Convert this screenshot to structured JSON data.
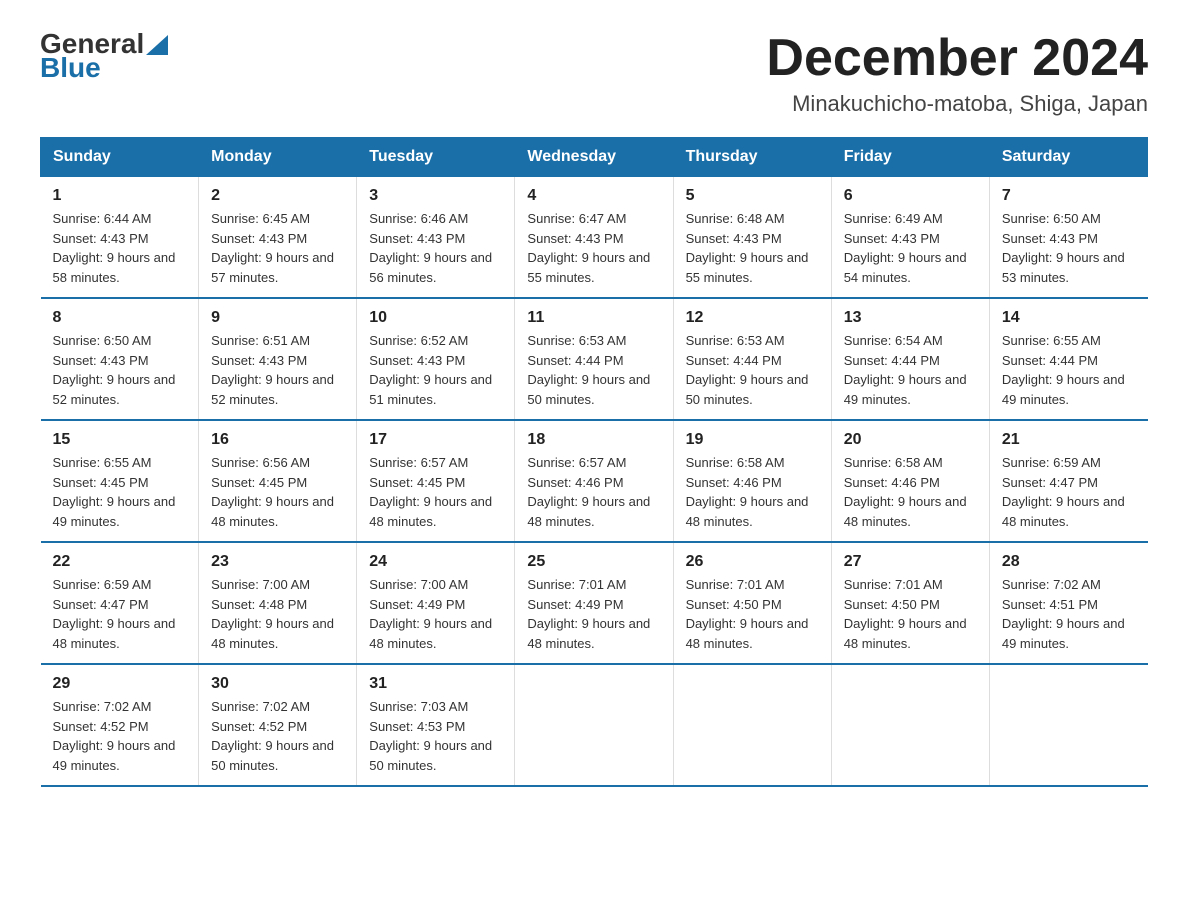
{
  "header": {
    "logo_general": "General",
    "logo_blue": "Blue",
    "month_title": "December 2024",
    "location": "Minakuchicho-matoba, Shiga, Japan"
  },
  "weekdays": [
    "Sunday",
    "Monday",
    "Tuesday",
    "Wednesday",
    "Thursday",
    "Friday",
    "Saturday"
  ],
  "weeks": [
    [
      {
        "day": "1",
        "sunrise": "6:44 AM",
        "sunset": "4:43 PM",
        "daylight": "9 hours and 58 minutes."
      },
      {
        "day": "2",
        "sunrise": "6:45 AM",
        "sunset": "4:43 PM",
        "daylight": "9 hours and 57 minutes."
      },
      {
        "day": "3",
        "sunrise": "6:46 AM",
        "sunset": "4:43 PM",
        "daylight": "9 hours and 56 minutes."
      },
      {
        "day": "4",
        "sunrise": "6:47 AM",
        "sunset": "4:43 PM",
        "daylight": "9 hours and 55 minutes."
      },
      {
        "day": "5",
        "sunrise": "6:48 AM",
        "sunset": "4:43 PM",
        "daylight": "9 hours and 55 minutes."
      },
      {
        "day": "6",
        "sunrise": "6:49 AM",
        "sunset": "4:43 PM",
        "daylight": "9 hours and 54 minutes."
      },
      {
        "day": "7",
        "sunrise": "6:50 AM",
        "sunset": "4:43 PM",
        "daylight": "9 hours and 53 minutes."
      }
    ],
    [
      {
        "day": "8",
        "sunrise": "6:50 AM",
        "sunset": "4:43 PM",
        "daylight": "9 hours and 52 minutes."
      },
      {
        "day": "9",
        "sunrise": "6:51 AM",
        "sunset": "4:43 PM",
        "daylight": "9 hours and 52 minutes."
      },
      {
        "day": "10",
        "sunrise": "6:52 AM",
        "sunset": "4:43 PM",
        "daylight": "9 hours and 51 minutes."
      },
      {
        "day": "11",
        "sunrise": "6:53 AM",
        "sunset": "4:44 PM",
        "daylight": "9 hours and 50 minutes."
      },
      {
        "day": "12",
        "sunrise": "6:53 AM",
        "sunset": "4:44 PM",
        "daylight": "9 hours and 50 minutes."
      },
      {
        "day": "13",
        "sunrise": "6:54 AM",
        "sunset": "4:44 PM",
        "daylight": "9 hours and 49 minutes."
      },
      {
        "day": "14",
        "sunrise": "6:55 AM",
        "sunset": "4:44 PM",
        "daylight": "9 hours and 49 minutes."
      }
    ],
    [
      {
        "day": "15",
        "sunrise": "6:55 AM",
        "sunset": "4:45 PM",
        "daylight": "9 hours and 49 minutes."
      },
      {
        "day": "16",
        "sunrise": "6:56 AM",
        "sunset": "4:45 PM",
        "daylight": "9 hours and 48 minutes."
      },
      {
        "day": "17",
        "sunrise": "6:57 AM",
        "sunset": "4:45 PM",
        "daylight": "9 hours and 48 minutes."
      },
      {
        "day": "18",
        "sunrise": "6:57 AM",
        "sunset": "4:46 PM",
        "daylight": "9 hours and 48 minutes."
      },
      {
        "day": "19",
        "sunrise": "6:58 AM",
        "sunset": "4:46 PM",
        "daylight": "9 hours and 48 minutes."
      },
      {
        "day": "20",
        "sunrise": "6:58 AM",
        "sunset": "4:46 PM",
        "daylight": "9 hours and 48 minutes."
      },
      {
        "day": "21",
        "sunrise": "6:59 AM",
        "sunset": "4:47 PM",
        "daylight": "9 hours and 48 minutes."
      }
    ],
    [
      {
        "day": "22",
        "sunrise": "6:59 AM",
        "sunset": "4:47 PM",
        "daylight": "9 hours and 48 minutes."
      },
      {
        "day": "23",
        "sunrise": "7:00 AM",
        "sunset": "4:48 PM",
        "daylight": "9 hours and 48 minutes."
      },
      {
        "day": "24",
        "sunrise": "7:00 AM",
        "sunset": "4:49 PM",
        "daylight": "9 hours and 48 minutes."
      },
      {
        "day": "25",
        "sunrise": "7:01 AM",
        "sunset": "4:49 PM",
        "daylight": "9 hours and 48 minutes."
      },
      {
        "day": "26",
        "sunrise": "7:01 AM",
        "sunset": "4:50 PM",
        "daylight": "9 hours and 48 minutes."
      },
      {
        "day": "27",
        "sunrise": "7:01 AM",
        "sunset": "4:50 PM",
        "daylight": "9 hours and 48 minutes."
      },
      {
        "day": "28",
        "sunrise": "7:02 AM",
        "sunset": "4:51 PM",
        "daylight": "9 hours and 49 minutes."
      }
    ],
    [
      {
        "day": "29",
        "sunrise": "7:02 AM",
        "sunset": "4:52 PM",
        "daylight": "9 hours and 49 minutes."
      },
      {
        "day": "30",
        "sunrise": "7:02 AM",
        "sunset": "4:52 PM",
        "daylight": "9 hours and 50 minutes."
      },
      {
        "day": "31",
        "sunrise": "7:03 AM",
        "sunset": "4:53 PM",
        "daylight": "9 hours and 50 minutes."
      },
      null,
      null,
      null,
      null
    ]
  ],
  "labels": {
    "sunrise": "Sunrise:",
    "sunset": "Sunset:",
    "daylight": "Daylight:"
  }
}
